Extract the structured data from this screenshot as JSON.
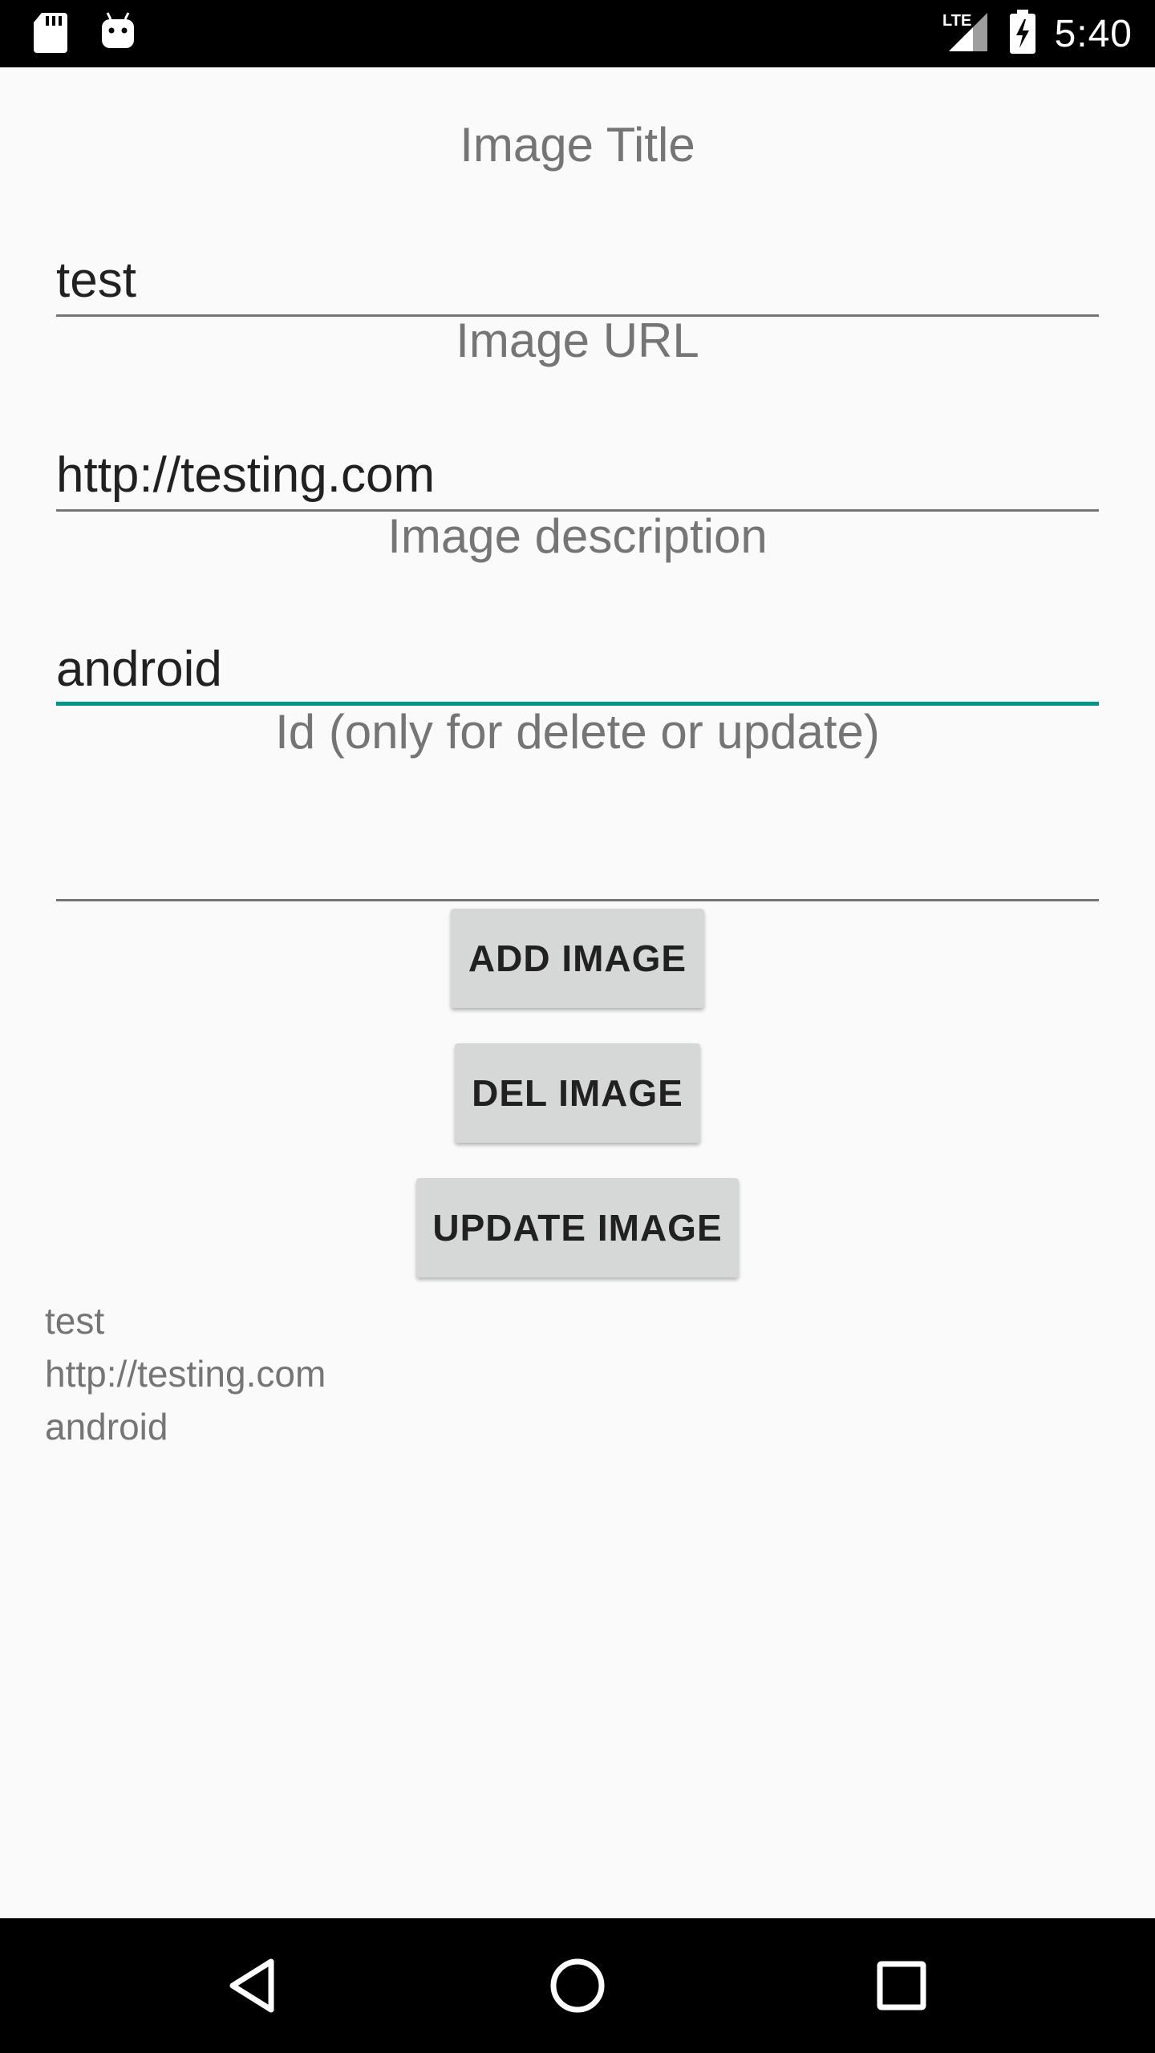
{
  "status_bar": {
    "time": "5:40",
    "network": "LTE",
    "left_icons": [
      "sd-card-icon",
      "android-icon"
    ],
    "right_icons": [
      "signal-icon",
      "battery-charging-icon"
    ]
  },
  "form": {
    "title_label": "Image Title",
    "title_value": "test",
    "url_label": "Image URL",
    "url_value": "http://testing.com",
    "description_label": "Image description",
    "description_value": "android",
    "id_label": "Id (only for delete or update)",
    "id_value": ""
  },
  "buttons": {
    "add": "ADD IMAGE",
    "delete": "DEL IMAGE",
    "update": "UPDATE IMAGE"
  },
  "result": {
    "lines": [
      "test",
      "http://testing.com",
      "android"
    ]
  },
  "navigation": {
    "icons": [
      "back-icon",
      "home-icon",
      "recents-icon"
    ]
  },
  "colors": {
    "accent": "#009688",
    "label": "#757575",
    "button_bg": "#d6d7d7"
  }
}
